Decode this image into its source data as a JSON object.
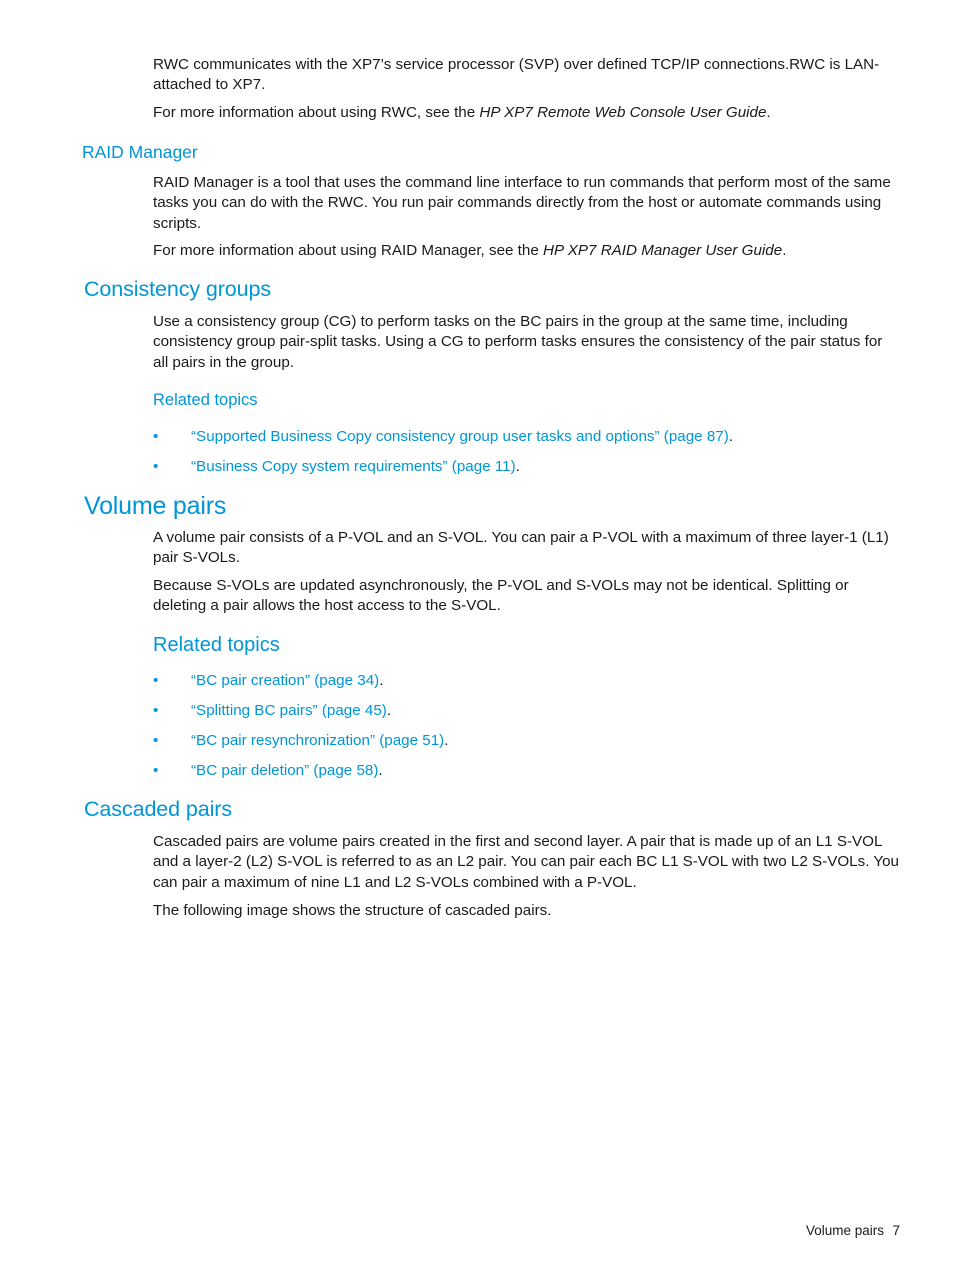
{
  "document": {
    "page_number": "7",
    "footer_section_title": "Volume pairs",
    "accent_color": "#0096D6",
    "body_color": "#1A1A1A"
  },
  "intro": {
    "para1_part1": "RWC communicates with the XP7’s service processor (SVP) over defined TCP/IP connections.RWC is LAN-attached to XP7.",
    "para2_lead": "For more information about using RWC, see the ",
    "para2_italic": "HP XP7 Remote Web Console User Guide",
    "para2_tail": "."
  },
  "raid_manager": {
    "heading": "RAID Manager",
    "para1": "RAID Manager is a tool that uses the command line interface to run commands that perform most of the same tasks you can do with the RWC. You run pair commands directly from the host or automate commands using scripts.",
    "para2_lead": "For more information about using RAID Manager, see the ",
    "para2_italic": "HP XP7 RAID Manager User Guide",
    "para2_tail": "."
  },
  "consistency_groups": {
    "heading": "Consistency groups",
    "para1": "Use a consistency group (CG) to perform tasks on the BC pairs in the group at the same time, including consistency group pair-split tasks. Using a CG to perform tasks ensures the consistency of the pair status for all pairs in the group.",
    "related_topics_heading": "Related topics",
    "links": [
      {
        "text": "“Supported Business Copy consistency group user tasks and options” (page 87)",
        "tail": "."
      },
      {
        "text": "“Business Copy system requirements” (page 11)",
        "tail": "."
      }
    ]
  },
  "volume_pairs": {
    "heading": "Volume pairs",
    "para1": "A volume pair consists of a P-VOL and an S-VOL. You can pair a P-VOL with a maximum of three layer-1 (L1) pair S-VOLs.",
    "para2": "Because S-VOLs are updated asynchronously, the P-VOL and S-VOLs may not be identical. Splitting or deleting a pair allows the host access to the S-VOL.",
    "related_topics_heading": "Related topics",
    "links": [
      {
        "text": "“BC pair creation” (page 34)",
        "tail": "."
      },
      {
        "text": "“Splitting BC pairs” (page 45)",
        "tail": "."
      },
      {
        "text": "“BC pair resynchronization” (page 51)",
        "tail": "."
      },
      {
        "text": "“BC pair deletion” (page 58)",
        "tail": "."
      }
    ]
  },
  "cascaded_pairs": {
    "heading": "Cascaded pairs",
    "para1": "Cascaded pairs are volume pairs created in the first and second layer. A pair that is made up of an L1 S-VOL and a layer-2 (L2) S-VOL is referred to as an L2 pair. You can pair each BC L1 S-VOL with two L2 S-VOLs. You can pair a maximum of nine L1 and L2 S-VOLs combined with a P-VOL.",
    "para2": "The following image shows the structure of cascaded pairs."
  },
  "bullet_glyph": "•"
}
